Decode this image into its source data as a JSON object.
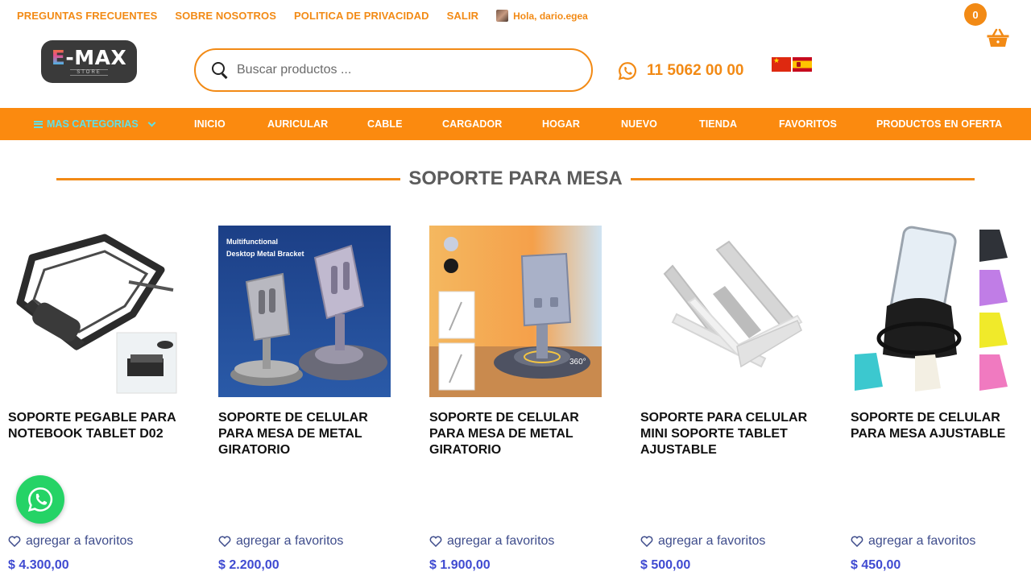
{
  "topbar": {
    "links": [
      "PREGUNTAS FRECUENTES",
      "SOBRE NOSOTROS",
      "POLITICA DE PRIVACIDAD",
      "SALIR"
    ],
    "greeting": "Hola, dario.egea"
  },
  "header": {
    "logo_main": "-MAX",
    "logo_letter": "E",
    "logo_sub": "STORE",
    "search_placeholder": "Buscar productos ...",
    "phone": "11 5062 00 00",
    "cart_count": "0"
  },
  "nav": {
    "categories_label": "MAS CATEGORIAS",
    "items": [
      "INICIO",
      "AURICULAR",
      "CABLE",
      "CARGADOR",
      "HOGAR",
      "NUEVO",
      "TIENDA",
      "FAVORITOS",
      "PRODUCTOS EN OFERTA"
    ]
  },
  "section": {
    "title": "SOPORTE PARA MESA"
  },
  "products": [
    {
      "name": "SOPORTE PEGABLE PARA NOTEBOOK TABLET D02",
      "fav_label": "agregar a favoritos",
      "price": "$ 4.300,00"
    },
    {
      "name": "SOPORTE DE CELULAR PARA MESA DE METAL GIRATORIO",
      "fav_label": "agregar a favoritos",
      "price": "$ 2.200,00",
      "image_text_1": "Multifunctional",
      "image_text_2": "Desktop Metal Bracket"
    },
    {
      "name": "SOPORTE DE CELULAR PARA MESA DE METAL GIRATORIO",
      "fav_label": "agregar a favoritos",
      "price": "$ 1.900,00",
      "image_badge": "360°"
    },
    {
      "name": "SOPORTE PARA CELULAR MINI SOPORTE TABLET AJUSTABLE",
      "fav_label": "agregar a favoritos",
      "price": "$ 500,00"
    },
    {
      "name": "SOPORTE DE CELULAR PARA MESA AJUSTABLE",
      "fav_label": "agregar a favoritos",
      "price": "$ 450,00"
    }
  ],
  "colors": {
    "accent": "#f28a15",
    "nav_bg": "#fb8a0f",
    "price": "#3f4ad1",
    "whatsapp": "#25d366"
  }
}
